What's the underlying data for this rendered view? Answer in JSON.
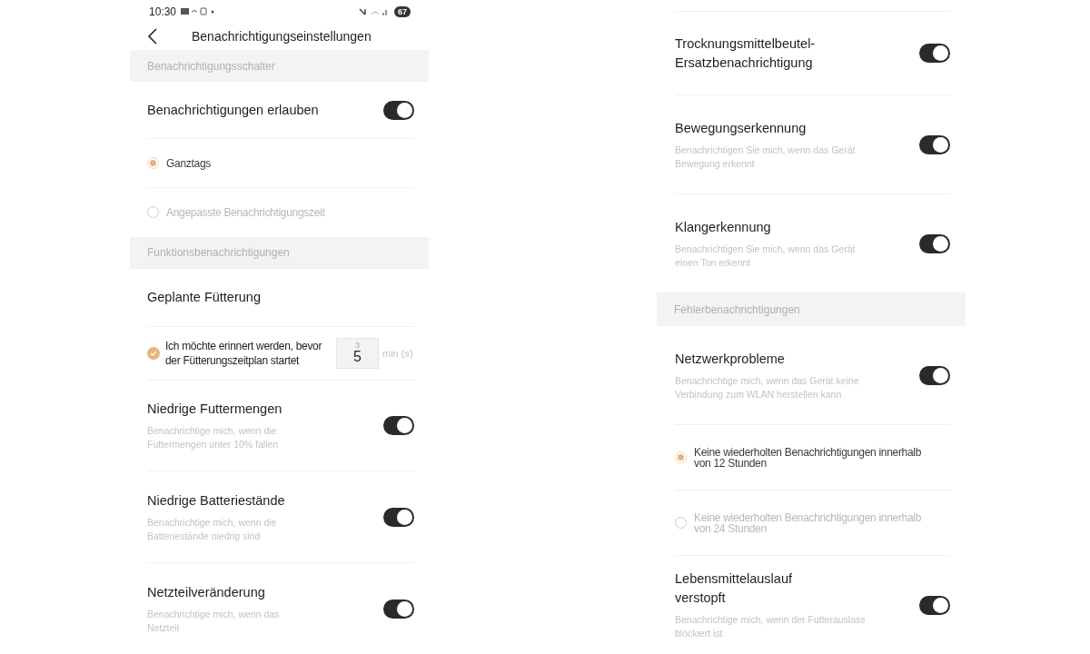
{
  "left_screen": {
    "status_bar": {
      "time": "10:30",
      "battery": "67"
    },
    "header": {
      "title": "Benachrichtigungseinstellungen"
    },
    "items": [
      {
        "kind": "section",
        "label": "Benachrichtigungsschalter"
      },
      {
        "kind": "toggle",
        "title": "Benachrichtigungen erlauben",
        "on": true
      },
      {
        "kind": "radio",
        "label": "Ganztags",
        "selected": true
      },
      {
        "kind": "radio",
        "label": "Angepasste Benachrichtigungszeit",
        "selected": false
      },
      {
        "kind": "section",
        "label": "Funktionsbenachrichtigungen"
      },
      {
        "kind": "title",
        "title": "Geplante Fütterung"
      },
      {
        "kind": "reminder",
        "label": "Ich möchte erinnert werden, bevor der Fütterungszeitplan startet",
        "checked": true,
        "picker_above": "3",
        "value": "5",
        "unit": "min (s)"
      },
      {
        "kind": "toggle",
        "title": "Niedrige Futtermengen",
        "description": "Benachrichtige mich, wenn die Futtermengen unter 10% fallen",
        "on": true
      },
      {
        "kind": "toggle",
        "title": "Niedrige Batteriestände",
        "description": "Benachrichtige mich, wenn die Batteriestände niedrig sind",
        "on": true
      },
      {
        "kind": "toggle",
        "title": "Netzteilveränderung",
        "description": "Benachrichtige mich, wenn das Netzteil",
        "on": true
      }
    ]
  },
  "right_screen": {
    "items": [
      {
        "kind": "toggle",
        "title": "Trocknungsmittelbeutel-Ersatzbenachrichtigung",
        "on": true
      },
      {
        "kind": "toggle",
        "title": "Bewegungserkennung",
        "description": "Benachrichtigen Sie mich, wenn das Gerät Bewegung erkennt",
        "on": true
      },
      {
        "kind": "toggle",
        "title": "Klangerkennung",
        "description": "Benachrichtigen Sie mich, wenn das Gerät einen Ton erkennt",
        "on": true
      },
      {
        "kind": "section",
        "label": "Fehlerbenachrichtigungen"
      },
      {
        "kind": "toggle",
        "title": "Netzwerkprobleme",
        "description": "Benachrichtige mich, wenn das Gerät keine Verbindung zum WLAN herstellen kann",
        "on": true
      },
      {
        "kind": "radio",
        "label": "Keine wiederholten Benachrichtigungen innerhalb von 12 Stunden",
        "selected": true
      },
      {
        "kind": "radio",
        "label": "Keine wiederholten Benachrichtigungen innerhalb von 24 Stunden",
        "selected": false
      },
      {
        "kind": "toggle",
        "title": "Lebensmittelauslauf verstopft",
        "description": "Benachrichtige mich, wenn der Futterauslass blockiert ist",
        "on": true
      }
    ]
  }
}
